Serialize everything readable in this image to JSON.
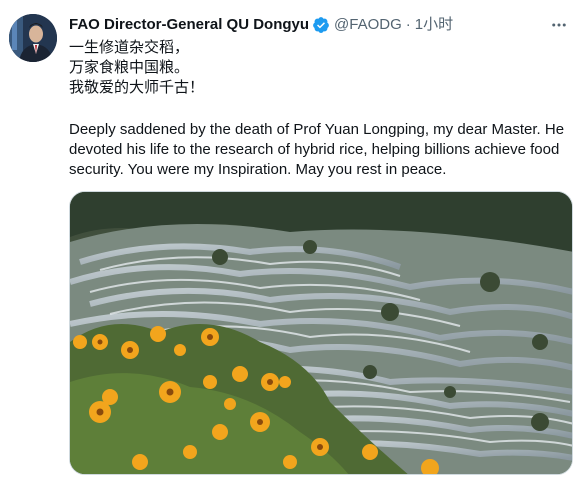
{
  "tweet": {
    "author_name": "FAO Director-General QU Dongyu",
    "handle": "@FAODG",
    "separator": "·",
    "time": "1小时",
    "text_lines_cn": [
      "一生修道杂交稻，",
      "万家食粮中国粮。",
      "我敬爱的大师千古！"
    ],
    "text_en": "Deeply saddened by the death of Prof Yuan Longping, my dear Master. He devoted his life to the research of hybrid rice, helping billions achieve food security. You were my Inspiration. May you rest in peace.",
    "verified_icon": "verified-badge-icon",
    "more_icon": "more-horizontal-icon",
    "media_subject": "rice terraces with yellow flowers"
  },
  "colors": {
    "text_primary": "#0f1419",
    "text_secondary": "#536471",
    "verified_blue": "#1d9bf0",
    "border": "#cfd9de"
  }
}
